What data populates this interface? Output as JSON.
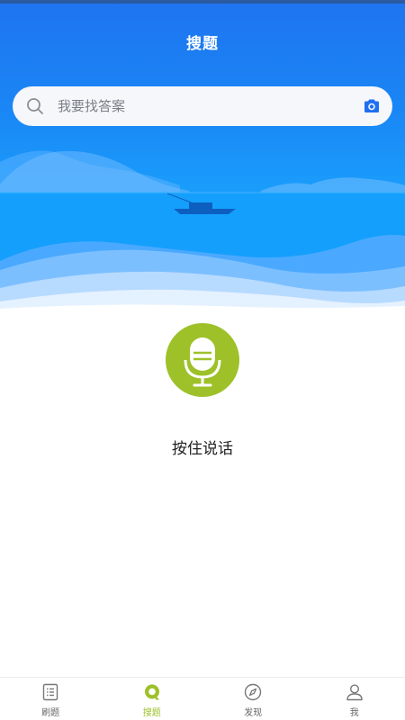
{
  "header": {
    "title": "搜题"
  },
  "search": {
    "placeholder": "我要找答案",
    "value": ""
  },
  "voice": {
    "label": "按住说话"
  },
  "tabbar": {
    "active": "搜题",
    "items": [
      {
        "label": "刷题",
        "icon": "list-icon"
      },
      {
        "label": "搜题",
        "icon": "search-q-icon"
      },
      {
        "label": "发现",
        "icon": "compass-icon"
      },
      {
        "label": "我",
        "icon": "user-icon"
      }
    ]
  },
  "colors": {
    "brand_blue": "#1a86f5",
    "accent_green": "#9ec12a",
    "camera_blue": "#1e6ff2"
  }
}
